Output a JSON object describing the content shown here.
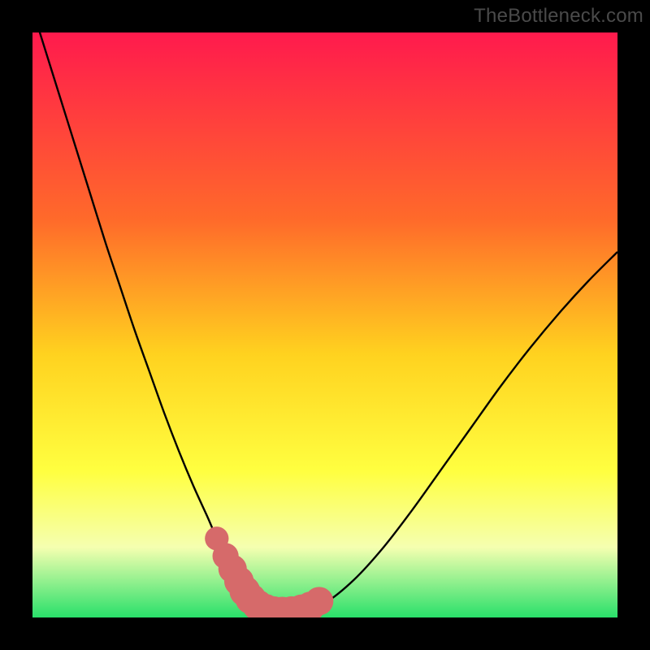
{
  "watermark": "TheBottleneck.com",
  "colors": {
    "background_black": "#000000",
    "gradient_top": "#ff1a4d",
    "gradient_mid1": "#ff6a2a",
    "gradient_mid2": "#ffd21f",
    "gradient_mid3": "#ffff40",
    "gradient_bottom_pale": "#f5ffb0",
    "gradient_green": "#29e06a",
    "curve_stroke": "#000000",
    "dot_fill": "#d66a6a",
    "watermark_text": "#4a4a4a"
  },
  "chart_data": {
    "type": "line",
    "title": "",
    "xlabel": "",
    "ylabel": "",
    "xlim": [
      0,
      100
    ],
    "ylim": [
      0,
      100
    ],
    "series": [
      {
        "name": "bottleneck-curve",
        "x": [
          0,
          2.5,
          5,
          7.5,
          10,
          12.5,
          15,
          17.5,
          20,
          22.5,
          25,
          27.5,
          30,
          31.5,
          33,
          34.5,
          36,
          37.5,
          39,
          41,
          43,
          46,
          50,
          55,
          60,
          65,
          70,
          75,
          80,
          85,
          90,
          95,
          100
        ],
        "y": [
          104,
          96,
          88,
          80,
          72,
          64,
          56.5,
          49,
          42,
          35,
          28.5,
          22.5,
          17,
          13.5,
          10.5,
          8,
          5.8,
          4,
          2.6,
          1.5,
          1,
          1.2,
          2.5,
          6.5,
          12,
          18.5,
          25.5,
          32.5,
          39.5,
          46,
          52,
          57.5,
          62.5
        ]
      }
    ],
    "marker_cluster": {
      "name": "highlight-dots",
      "points": [
        {
          "x": 31.5,
          "y": 13.5,
          "r": 1.2
        },
        {
          "x": 33.0,
          "y": 10.5,
          "r": 1.4
        },
        {
          "x": 34.2,
          "y": 8.3,
          "r": 1.6
        },
        {
          "x": 35.3,
          "y": 6.2,
          "r": 1.7
        },
        {
          "x": 36.3,
          "y": 4.5,
          "r": 1.8
        },
        {
          "x": 37.3,
          "y": 3.2,
          "r": 1.8
        },
        {
          "x": 38.5,
          "y": 2.1,
          "r": 1.8
        },
        {
          "x": 39.8,
          "y": 1.4,
          "r": 1.8
        },
        {
          "x": 41.2,
          "y": 1.0,
          "r": 1.8
        },
        {
          "x": 42.7,
          "y": 0.9,
          "r": 1.8
        },
        {
          "x": 44.3,
          "y": 1.0,
          "r": 1.8
        },
        {
          "x": 46.0,
          "y": 1.3,
          "r": 1.8
        },
        {
          "x": 47.5,
          "y": 1.9,
          "r": 1.7
        },
        {
          "x": 49.0,
          "y": 2.8,
          "r": 1.6
        }
      ]
    },
    "gradient_stops": [
      {
        "offset": 0.0,
        "color": "#ff1a4d"
      },
      {
        "offset": 0.32,
        "color": "#ff6a2a"
      },
      {
        "offset": 0.55,
        "color": "#ffd21f"
      },
      {
        "offset": 0.75,
        "color": "#ffff40"
      },
      {
        "offset": 0.88,
        "color": "#f5ffb0"
      },
      {
        "offset": 1.0,
        "color": "#29e06a"
      }
    ]
  }
}
